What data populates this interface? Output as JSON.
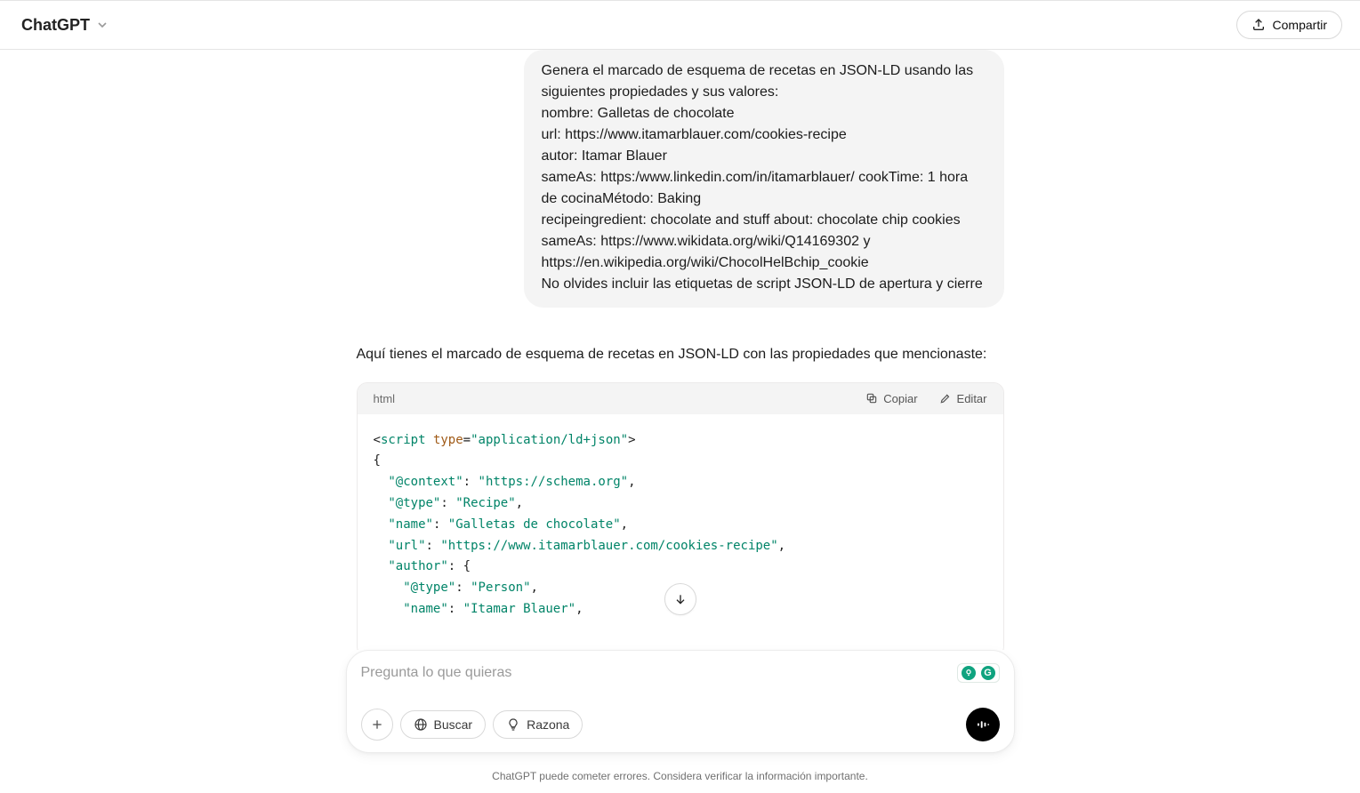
{
  "header": {
    "brand": "ChatGPT",
    "share_label": "Compartir"
  },
  "user_message": "Genera el marcado de esquema de recetas en JSON-LD usando las siguientes propiedades y sus valores:\nnombre: Galletas de chocolate\nurl: https://www.itamarblauer.com/cookies-recipe\nautor: Itamar Blauer\nsameAs: https:/www.linkedin.com/in/itamarblauer/ cookTime: 1 hora de cocinaMétodo: Baking\nrecipeingredient: chocolate and stuff about: chocolate chip cookies sameAs: https://www.wikidata.org/wiki/Q14169302 y https://en.wikipedia.org/wiki/ChocolHelBchip_cookie\nNo olvides incluir las etiquetas de script JSON-LD de apertura y cierre",
  "assistant_intro": "Aquí tienes el marcado de esquema de recetas en JSON-LD con las propiedades que mencionaste:",
  "codeblock": {
    "lang": "html",
    "copy_label": "Copiar",
    "edit_label": "Editar",
    "lines": {
      "l1_open": "<",
      "l1_tag": "script",
      "l1_sp": " ",
      "l1_attr": "type",
      "l1_eq": "=",
      "l1_val": "\"application/ld+json\"",
      "l1_close": ">",
      "l2": "{",
      "l3_k": "\"@context\"",
      "l3_c": ": ",
      "l3_v": "\"https://schema.org\"",
      "l3_p": ",",
      "l4_k": "\"@type\"",
      "l4_c": ": ",
      "l4_v": "\"Recipe\"",
      "l4_p": ",",
      "l5_k": "\"name\"",
      "l5_c": ": ",
      "l5_v": "\"Galletas de chocolate\"",
      "l5_p": ",",
      "l6_k": "\"url\"",
      "l6_c": ": ",
      "l6_v": "\"https://www.itamarblauer.com/cookies-recipe\"",
      "l6_p": ",",
      "l7_k": "\"author\"",
      "l7_c": ": {",
      "l8_k": "\"@type\"",
      "l8_c": ": ",
      "l8_v": "\"Person\"",
      "l8_p": ",",
      "l9_k": "\"name\"",
      "l9_c": ": ",
      "l9_v": "\"Itamar Blauer\"",
      "l9_p": ","
    }
  },
  "composer": {
    "placeholder": "Pregunta lo que quieras",
    "search_label": "Buscar",
    "reason_label": "Razona"
  },
  "disclaimer": "ChatGPT puede cometer errores. Considera verificar la información importante."
}
